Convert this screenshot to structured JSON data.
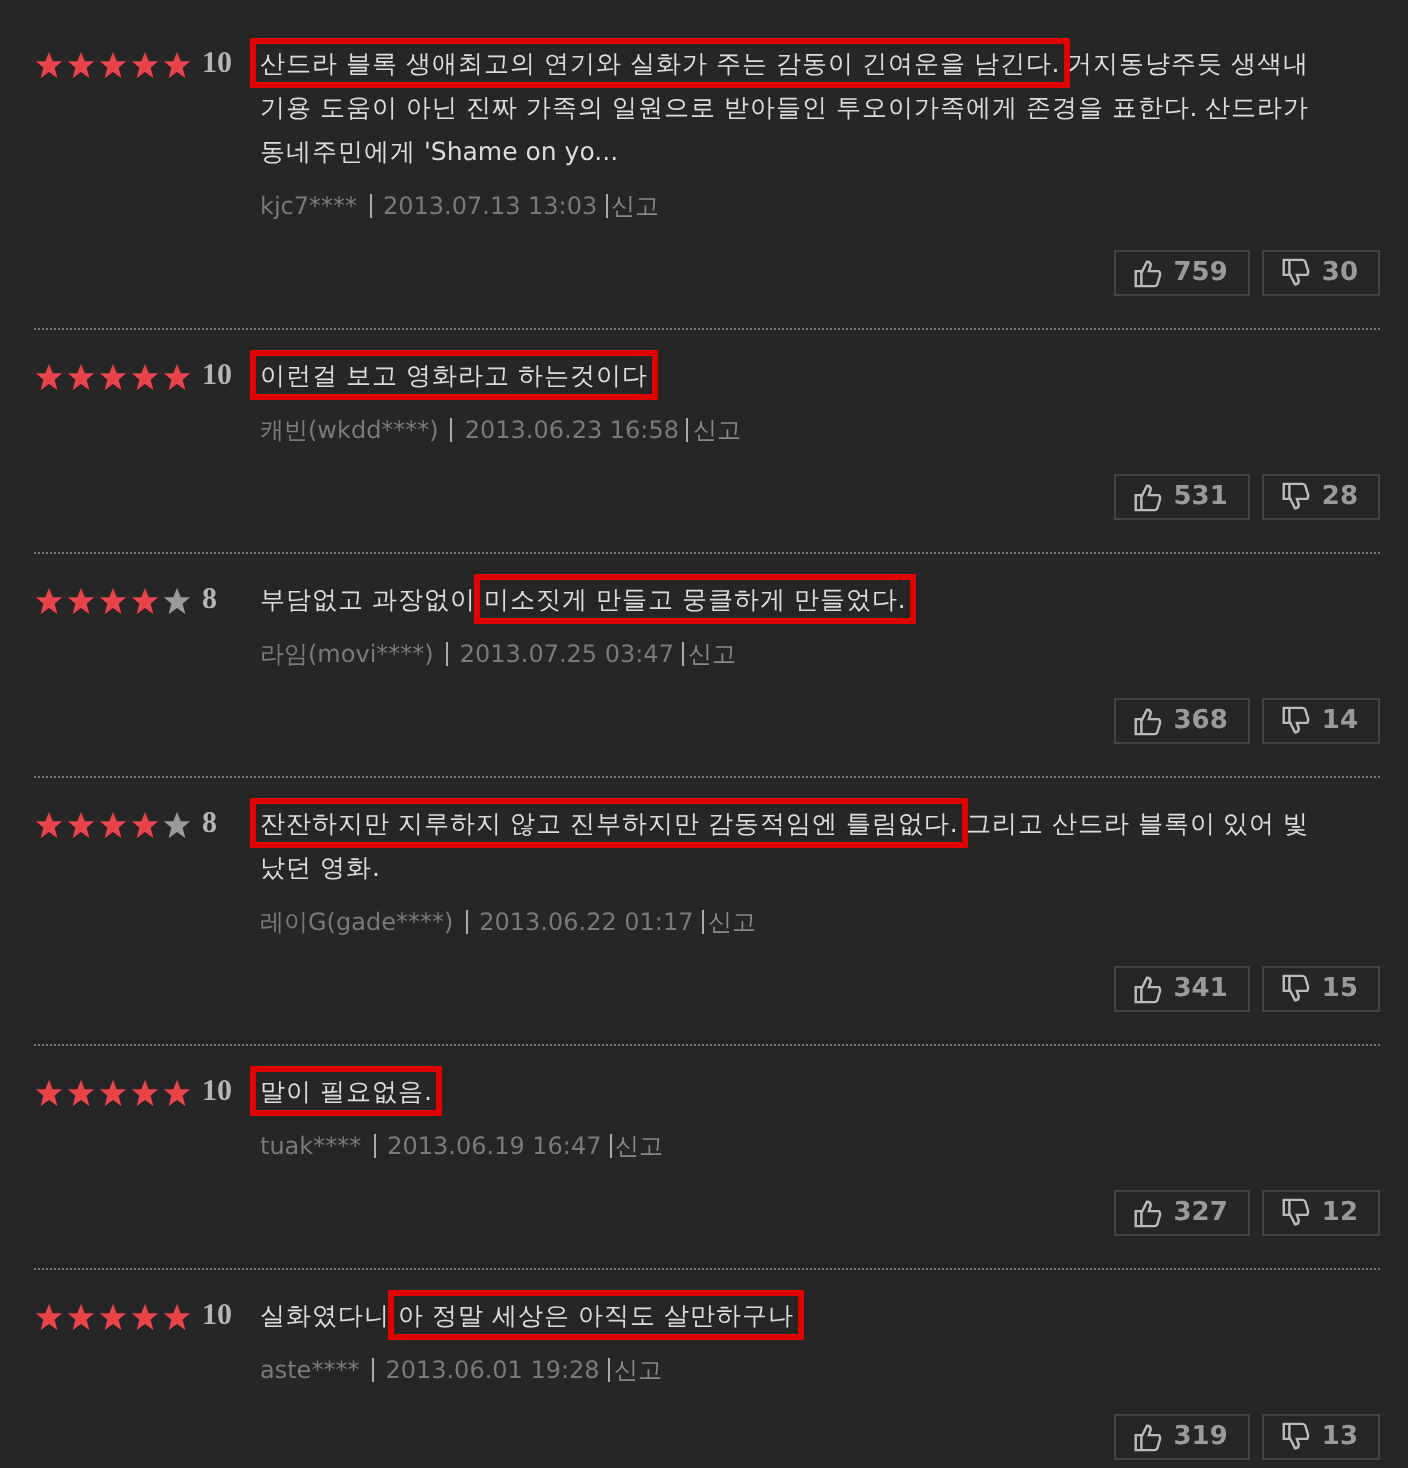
{
  "reviews": [
    {
      "stars": 5,
      "score": "10",
      "segments": [
        {
          "text": "산드라 블록 생애최고의 연기와 실화가 주는 감동이 긴여운을 남긴다.",
          "boxed": true
        },
        {
          "text": " 거지동냥주듯 생색내기용 도움이 아닌 진짜 가족의 일원으로 받아들인 투오이가족에게 존경을 표한다. 산드라가 동네주민에게 'Shame on yo...",
          "boxed": false
        }
      ],
      "author": "kjc7****",
      "date": "2013.07.13 13:03",
      "report": "신고",
      "likes": "759",
      "dislikes": "30"
    },
    {
      "stars": 5,
      "score": "10",
      "segments": [
        {
          "text": "이런걸 보고 영화라고 하는것이다",
          "boxed": true
        }
      ],
      "author": "캐빈(wkdd****)",
      "date": "2013.06.23 16:58",
      "report": "신고",
      "likes": "531",
      "dislikes": "28"
    },
    {
      "stars": 4,
      "score": "8",
      "segments": [
        {
          "text": "부담없고 과장없이 ",
          "boxed": false
        },
        {
          "text": "미소짓게 만들고 뭉클하게 만들었다.",
          "boxed": true
        }
      ],
      "author": "라임(movi****)",
      "date": "2013.07.25 03:47",
      "report": "신고",
      "likes": "368",
      "dislikes": "14"
    },
    {
      "stars": 4,
      "score": "8",
      "segments": [
        {
          "text": "잔잔하지만 지루하지 않고 진부하지만 감동적임엔 틀림없다.",
          "boxed": true
        },
        {
          "text": " 그리고 산드라 블록이 있어 빛났던 영화.",
          "boxed": false
        }
      ],
      "author": "레이G(gade****)",
      "date": "2013.06.22 01:17",
      "report": "신고",
      "likes": "341",
      "dislikes": "15"
    },
    {
      "stars": 5,
      "score": "10",
      "segments": [
        {
          "text": "말이 필요없음.",
          "boxed": true
        }
      ],
      "author": "tuak****",
      "date": "2013.06.19 16:47",
      "report": "신고",
      "likes": "327",
      "dislikes": "12"
    },
    {
      "stars": 5,
      "score": "10",
      "segments": [
        {
          "text": "실화였다니 ",
          "boxed": false
        },
        {
          "text": "아 정말 세상은 아직도 살만하구나",
          "boxed": true
        }
      ],
      "author": "aste****",
      "date": "2013.06.01 19:28",
      "report": "신고",
      "likes": "319",
      "dislikes": "13"
    }
  ]
}
